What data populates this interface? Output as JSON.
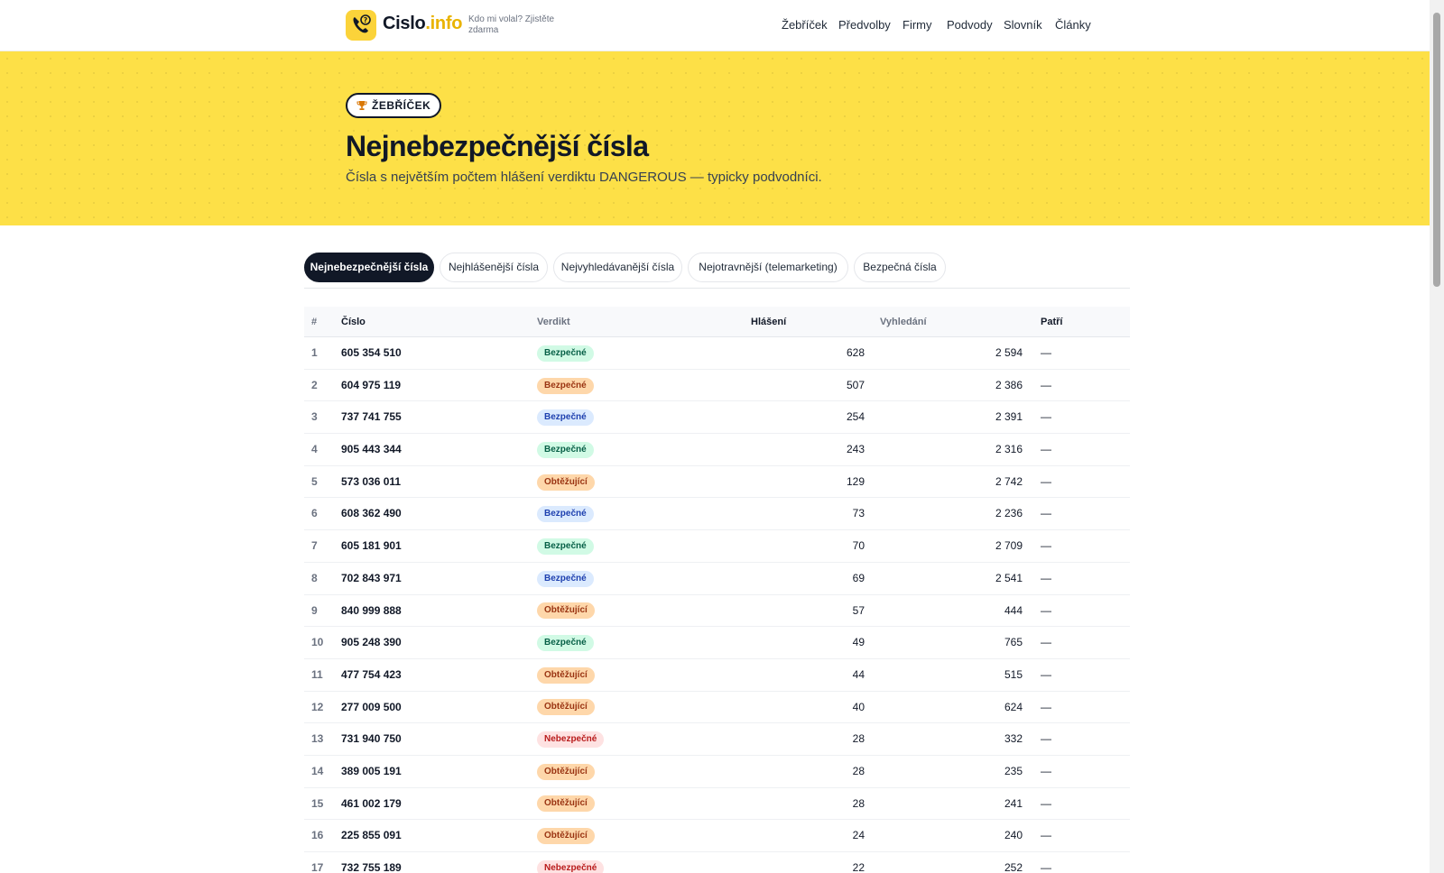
{
  "header": {
    "logo_main": "Cislo",
    "logo_dot": ".info",
    "tagline": "Kdo mi volal? Zjistěte zdarma",
    "nav": [
      "Žebříček",
      "Předvolby",
      "Firmy",
      "Podvody",
      "Slovník",
      "Články"
    ]
  },
  "hero": {
    "badge": "ŽEBŘÍČEK",
    "title": "Nejnebezpečnější čísla",
    "subtitle": "Čísla s největším počtem hlášení verdiktu DANGEROUS — typicky podvodníci."
  },
  "tabs": [
    {
      "label": "Nejnebezpečnější čísla",
      "active": true
    },
    {
      "label": "Nejhlášenější čísla",
      "active": false
    },
    {
      "label": "Nejvyhledávanější čísla",
      "active": false
    },
    {
      "label": "Nejotravnější (telemarketing)",
      "active": false
    },
    {
      "label": "Bezpečná čísla",
      "active": false
    }
  ],
  "table": {
    "headers": {
      "rank": "#",
      "number": "Číslo",
      "verdict": "Verdikt",
      "reports": "Hlášení",
      "searches": "Vyhledání",
      "owner": "Patří"
    },
    "rows": [
      {
        "rank": "1",
        "number": "605 354 510",
        "verdict": "Bezpečné",
        "tone": "green",
        "reports": "628",
        "searches": "2 594",
        "owner": "—"
      },
      {
        "rank": "2",
        "number": "604 975 119",
        "verdict": "Bezpečné",
        "tone": "orange",
        "reports": "507",
        "searches": "2 386",
        "owner": "—"
      },
      {
        "rank": "3",
        "number": "737 741 755",
        "verdict": "Bezpečné",
        "tone": "blue",
        "reports": "254",
        "searches": "2 391",
        "owner": "—"
      },
      {
        "rank": "4",
        "number": "905 443 344",
        "verdict": "Bezpečné",
        "tone": "green",
        "reports": "243",
        "searches": "2 316",
        "owner": "—"
      },
      {
        "rank": "5",
        "number": "573 036 011",
        "verdict": "Obtěžující",
        "tone": "orange",
        "reports": "129",
        "searches": "2 742",
        "owner": "—"
      },
      {
        "rank": "6",
        "number": "608 362 490",
        "verdict": "Bezpečné",
        "tone": "blue",
        "reports": "73",
        "searches": "2 236",
        "owner": "—"
      },
      {
        "rank": "7",
        "number": "605 181 901",
        "verdict": "Bezpečné",
        "tone": "green",
        "reports": "70",
        "searches": "2 709",
        "owner": "—"
      },
      {
        "rank": "8",
        "number": "702 843 971",
        "verdict": "Bezpečné",
        "tone": "blue",
        "reports": "69",
        "searches": "2 541",
        "owner": "—"
      },
      {
        "rank": "9",
        "number": "840 999 888",
        "verdict": "Obtěžující",
        "tone": "orange",
        "reports": "57",
        "searches": "444",
        "owner": "—"
      },
      {
        "rank": "10",
        "number": "905 248 390",
        "verdict": "Bezpečné",
        "tone": "green",
        "reports": "49",
        "searches": "765",
        "owner": "—"
      },
      {
        "rank": "11",
        "number": "477 754 423",
        "verdict": "Obtěžující",
        "tone": "orange",
        "reports": "44",
        "searches": "515",
        "owner": "—"
      },
      {
        "rank": "12",
        "number": "277 009 500",
        "verdict": "Obtěžující",
        "tone": "orange",
        "reports": "40",
        "searches": "624",
        "owner": "—"
      },
      {
        "rank": "13",
        "number": "731 940 750",
        "verdict": "Nebezpečné",
        "tone": "red",
        "reports": "28",
        "searches": "332",
        "owner": "—"
      },
      {
        "rank": "14",
        "number": "389 005 191",
        "verdict": "Obtěžující",
        "tone": "orange",
        "reports": "28",
        "searches": "235",
        "owner": "—"
      },
      {
        "rank": "15",
        "number": "461 002 179",
        "verdict": "Obtěžující",
        "tone": "orange",
        "reports": "28",
        "searches": "241",
        "owner": "—"
      },
      {
        "rank": "16",
        "number": "225 855 091",
        "verdict": "Obtěžující",
        "tone": "orange",
        "reports": "24",
        "searches": "240",
        "owner": "—"
      },
      {
        "rank": "17",
        "number": "732 755 189",
        "verdict": "Nebezpečné",
        "tone": "red",
        "reports": "22",
        "searches": "252",
        "owner": "—"
      }
    ]
  },
  "colors": {
    "accent_yellow": "#fde047",
    "brand_dark": "#111827",
    "logo_yellow": "#fbd33a"
  },
  "icons": {
    "logo": "phone-question-icon",
    "badge": "trophy-icon"
  }
}
